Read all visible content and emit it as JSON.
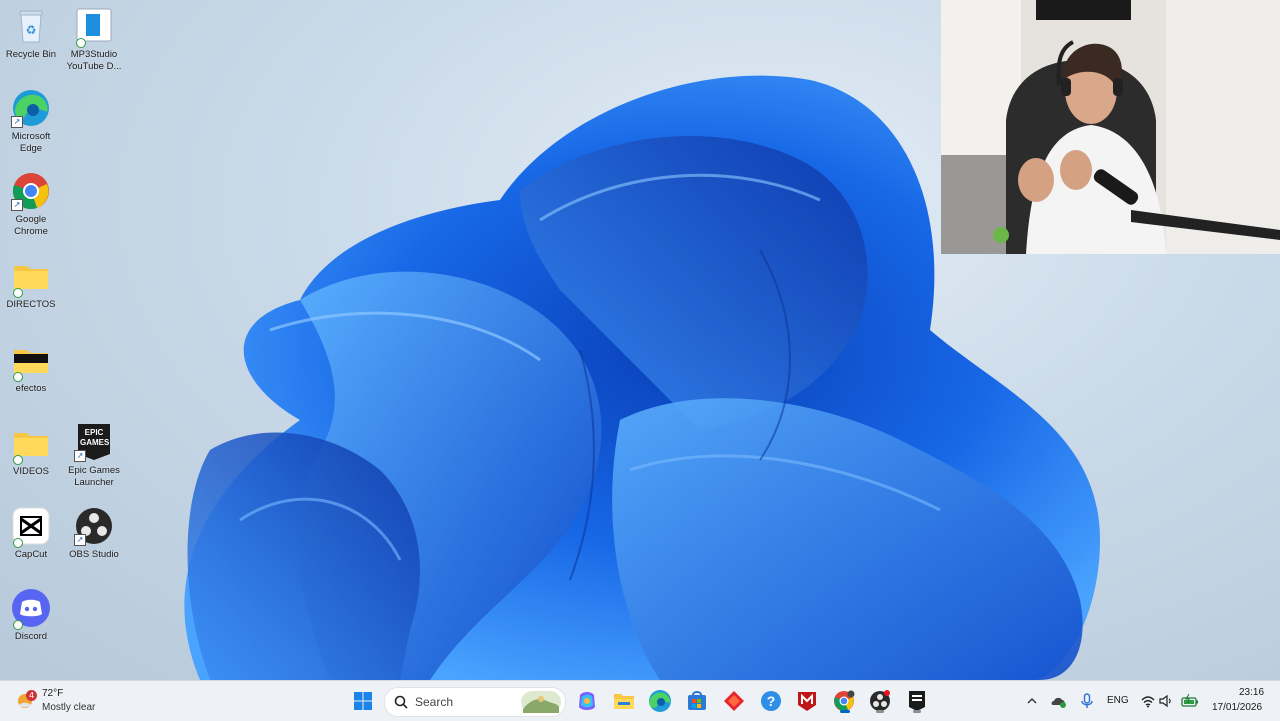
{
  "desktop": {
    "icons": [
      {
        "label": "Recycle Bin"
      },
      {
        "label": "MP3Studio YouTube D..."
      },
      {
        "label": "Microsoft Edge"
      },
      {
        "label": "Google Chrome"
      },
      {
        "label": "DIRECTOS"
      },
      {
        "label": "efectos"
      },
      {
        "label": "VIDEOS"
      },
      {
        "label": "Epic Games Launcher"
      },
      {
        "label": "CapCut"
      },
      {
        "label": "OBS Studio"
      },
      {
        "label": "Discord"
      }
    ],
    "epic_logo_text": "EPIC GAMES"
  },
  "taskbar": {
    "weather": {
      "temp": "72°F",
      "condition": "Mostly clear",
      "badge_count": "4"
    },
    "search_placeholder": "Search",
    "apps": [
      {
        "name": "start-icon"
      },
      {
        "name": "widgets-icon"
      },
      {
        "name": "copilot-icon"
      },
      {
        "name": "file-explorer-icon"
      },
      {
        "name": "edge-icon"
      },
      {
        "name": "store-icon"
      },
      {
        "name": "diamond-app-icon"
      },
      {
        "name": "help-icon"
      },
      {
        "name": "mcafee-icon"
      },
      {
        "name": "chrome-icon"
      },
      {
        "name": "obs-icon"
      },
      {
        "name": "epic-games-icon"
      }
    ],
    "tray": {
      "language": "ENG",
      "time": "23:16",
      "date": "17/01/2026"
    }
  },
  "colors": {
    "accent": "#0067c0",
    "wallpaper_bloom": "#1a6ee8",
    "taskbar_bg": "#eef1f6"
  }
}
